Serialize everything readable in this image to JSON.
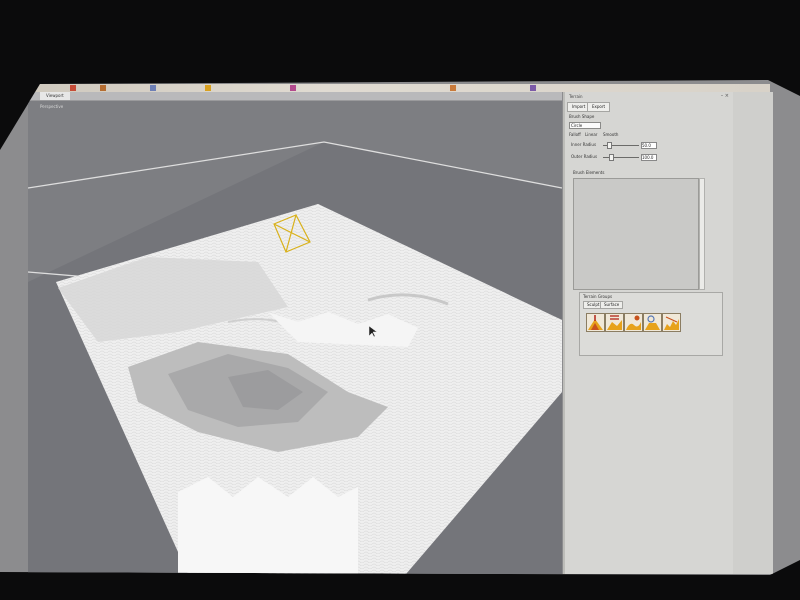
{
  "top_bar": {
    "icons": [
      "toolbar-icon-1",
      "toolbar-icon-2",
      "toolbar-icon-3",
      "toolbar-icon-4",
      "toolbar-icon-5",
      "toolbar-icon-6",
      "toolbar-icon-7"
    ]
  },
  "viewport": {
    "tab_label": "Viewport",
    "view_name": "Perspective"
  },
  "panel": {
    "title": "Terrain",
    "window_controls": "– ×",
    "tabs": [
      "Import",
      "Export"
    ],
    "brush_shape_label": "Brush Shape",
    "brush_shape_value": "Circle",
    "falloff_label": "Falloff",
    "falloff_options": [
      "Linear",
      "Smooth"
    ],
    "inner_radius_label": "Inner Radius",
    "inner_radius_value": "50.0",
    "outer_radius_label": "Outer Radius",
    "outer_radius_value": "100.0",
    "brush_elements_label": "Brush Elements",
    "group_label": "Terrain Groups",
    "group_tabs": [
      "Sculpt",
      "Surface"
    ],
    "tools": [
      "raise-tool-icon",
      "lower-tool-icon",
      "smooth-tool-icon",
      "flatten-tool-icon",
      "noise-tool-icon"
    ]
  },
  "colors": {
    "selection_gizmo": "#d9b11a",
    "terrain": "#f3f3f3",
    "viewport_bg": "#7d7e82",
    "panel_bg": "#d6d6d3"
  }
}
